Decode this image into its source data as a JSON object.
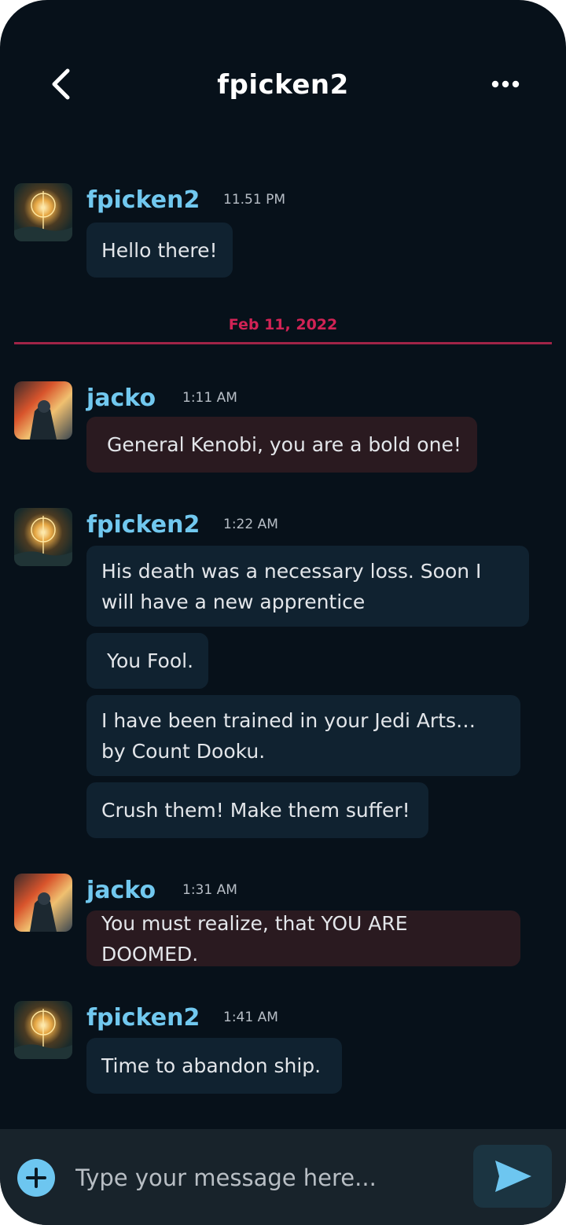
{
  "header": {
    "title": "fpicken2"
  },
  "messages": [
    {
      "user": "fpicken2",
      "time": "11.51 PM",
      "texts": [
        "Hello there!"
      ]
    },
    {
      "user": "jacko",
      "time": "1:11 AM",
      "texts": [
        "General Kenobi, you are a bold one!"
      ]
    },
    {
      "user": "fpicken2",
      "time": "1:22 AM",
      "texts": [
        "His death was a necessary loss. Soon I will have a new apprentice",
        "You Fool.",
        "I have been trained in your Jedi Arts… by Count Dooku.",
        "Crush them! Make them suffer!"
      ]
    },
    {
      "user": "jacko",
      "time": "1:31 AM",
      "texts": [
        "You must realize, that YOU ARE DOOMED."
      ]
    },
    {
      "user": "fpicken2",
      "time": "1:41 AM",
      "texts": [
        "Time to abandon ship."
      ]
    }
  ],
  "date_divider": "Feb 11, 2022",
  "composer": {
    "placeholder": "Type your message here..."
  },
  "colors": {
    "background": "#07111a",
    "username": "#71c8ef",
    "own_bubble": "#102230",
    "other_bubble": "#2a1a20",
    "divider": "#d12355",
    "accent": "#6dc6f0"
  },
  "icons": {
    "back": "chevron-left-icon",
    "more": "more-horizontal-icon",
    "add": "plus-circle-icon",
    "send": "send-icon"
  }
}
